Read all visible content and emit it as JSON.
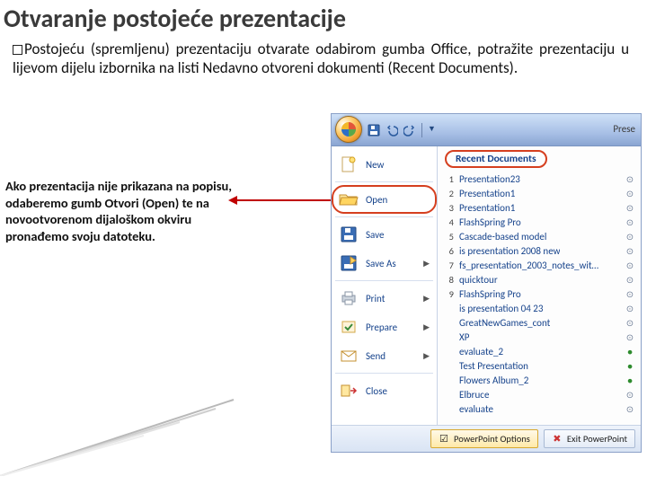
{
  "title": "Otvaranje postojeće prezentacije",
  "body_first_word": "Postojeću",
  "body_rest": " (spremljenu) prezentaciju otvarate odabirom gumba Office, potražite prezentaciju u lijevom dijelu izbornika na listi Nedavno otvoreni dokumenti (Recent Documents).",
  "note": "Ako prezentacija nije prikazana na popisu, odaberemo gumb Otvori (Open) te na novootvorenom dijaloškom okviru pronađemo svoju datoteku.",
  "ribbon_tab": "Prese",
  "recent_header": "Recent Documents",
  "commands": {
    "new": "New",
    "open": "Open",
    "save": "Save",
    "save_as": "Save As",
    "print": "Print",
    "prepare": "Prepare",
    "send": "Send",
    "close": "Close"
  },
  "recent_docs": [
    {
      "n": "1",
      "name": "Presentation23",
      "pin": false
    },
    {
      "n": "2",
      "name": "Presentation1",
      "pin": false
    },
    {
      "n": "3",
      "name": "Presentation1",
      "pin": false
    },
    {
      "n": "4",
      "name": "FlashSpring Pro",
      "pin": false
    },
    {
      "n": "5",
      "name": "Cascade-based model",
      "pin": false
    },
    {
      "n": "6",
      "name": "is presentation 2008 new",
      "pin": false
    },
    {
      "n": "7",
      "name": "fs_presentation_2003_notes_with_sound1",
      "pin": false
    },
    {
      "n": "8",
      "name": "quicktour",
      "pin": false
    },
    {
      "n": "9",
      "name": "FlashSpring Pro",
      "pin": false
    },
    {
      "n": "",
      "name": "is presentation 04 23",
      "pin": false
    },
    {
      "n": "",
      "name": "GreatNewGames_cont",
      "pin": false
    },
    {
      "n": "",
      "name": "XP",
      "pin": false
    },
    {
      "n": "",
      "name": "evaluate_2",
      "pin": true
    },
    {
      "n": "",
      "name": "Test Presentation",
      "pin": true
    },
    {
      "n": "",
      "name": "Flowers Album_2",
      "pin": true
    },
    {
      "n": "",
      "name": "Elbruce",
      "pin": false
    },
    {
      "n": "",
      "name": "evaluate",
      "pin": false
    }
  ],
  "buttons": {
    "options_label": "PowerPoint Options",
    "exit_label": "Exit PowerPoint"
  }
}
